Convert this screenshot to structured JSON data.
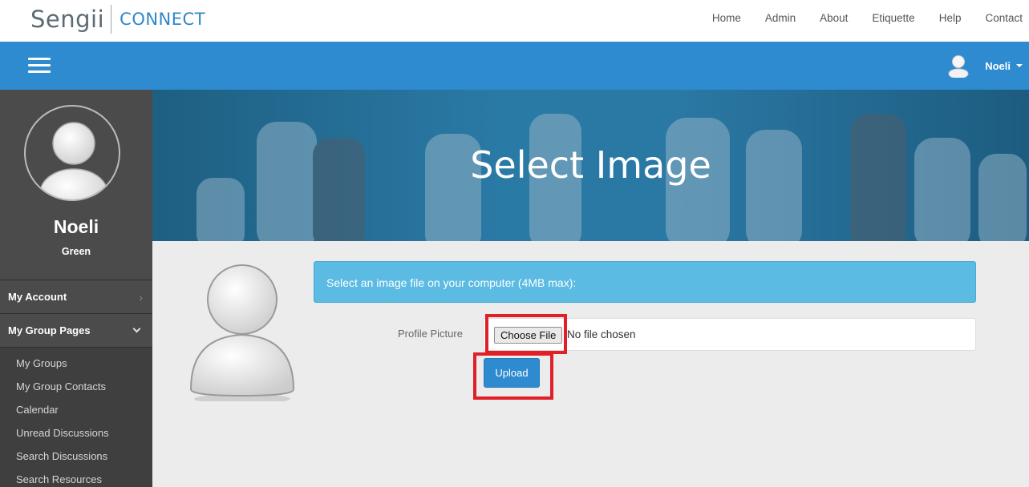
{
  "header": {
    "logo_main": "Sengii",
    "logo_sub": "CONNECT",
    "nav": [
      "Home",
      "Admin",
      "About",
      "Etiquette",
      "Help",
      "Contact"
    ]
  },
  "bluebar": {
    "user_name": "Noeli",
    "menu_icon": "hamburger-icon",
    "avatar_icon": "user-avatar-icon"
  },
  "sidebar": {
    "name": "Noeli",
    "subname": "Green",
    "sections": {
      "account": "My Account",
      "group_pages": "My Group Pages"
    },
    "links": [
      "My Groups",
      "My Group Contacts",
      "Calendar",
      "Unread Discussions",
      "Search Discussions",
      "Search Resources"
    ]
  },
  "banner": {
    "title": "Select Image"
  },
  "form": {
    "instruction": "Select an image file on your computer (4MB max):",
    "field_label": "Profile Picture",
    "choose_label": "Choose File",
    "file_status": "No file chosen",
    "upload_label": "Upload"
  },
  "colors": {
    "primary": "#2f8bcf",
    "info": "#5bbbe2",
    "sidebar": "#3f3f3f",
    "highlight": "#e01f26"
  }
}
